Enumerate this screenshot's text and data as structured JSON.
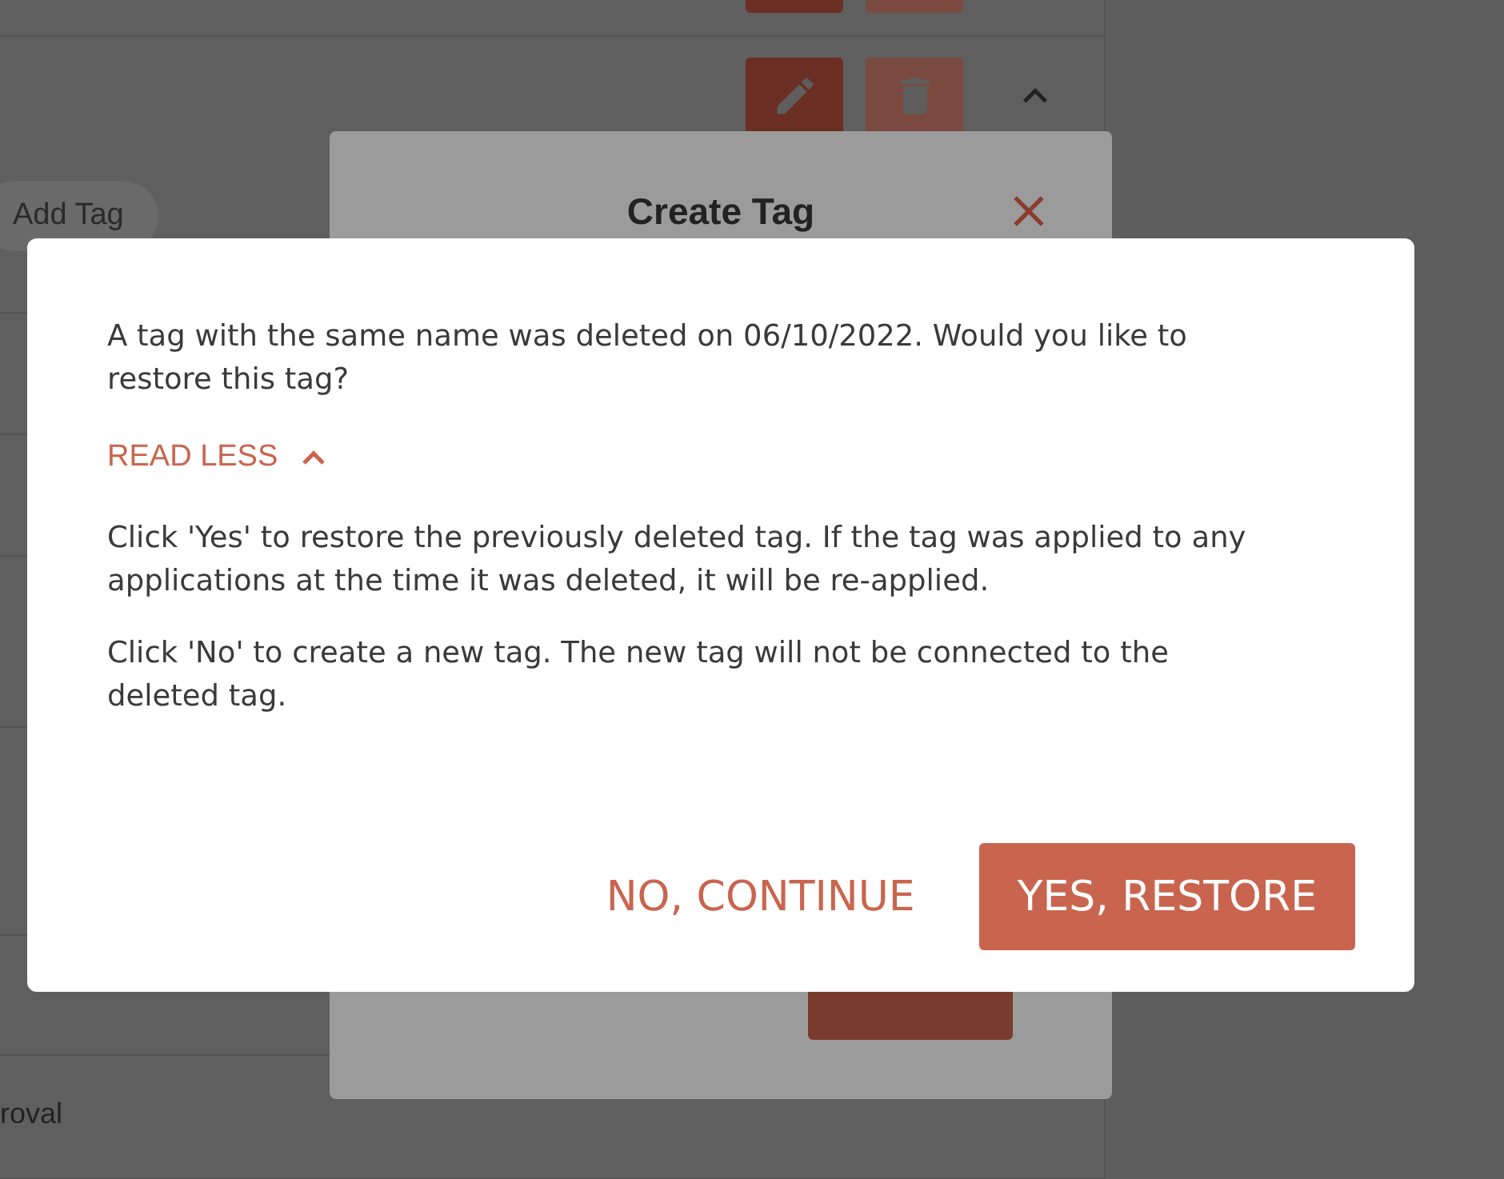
{
  "page": {
    "add_tag_chip": "Add Tag",
    "row_text": "roval",
    "row_expanded": true
  },
  "create_tag_modal": {
    "title": "Create Tag"
  },
  "restore_dialog": {
    "message": "A tag with the same name was deleted on 06/10/2022. Would you like to restore this tag?",
    "toggle": {
      "label": "READ LESS",
      "expanded": true
    },
    "details": [
      "Click 'Yes' to restore the previously deleted tag. If the tag was applied to any applications at the time it was deleted, it will be re-applied.",
      "Click 'No' to create a new tag. The new tag will not be connected to the deleted tag."
    ],
    "buttons": [
      {
        "label": "NO, CONTINUE",
        "kind": "text"
      },
      {
        "label": "YES, RESTORE",
        "kind": "filled"
      }
    ]
  }
}
